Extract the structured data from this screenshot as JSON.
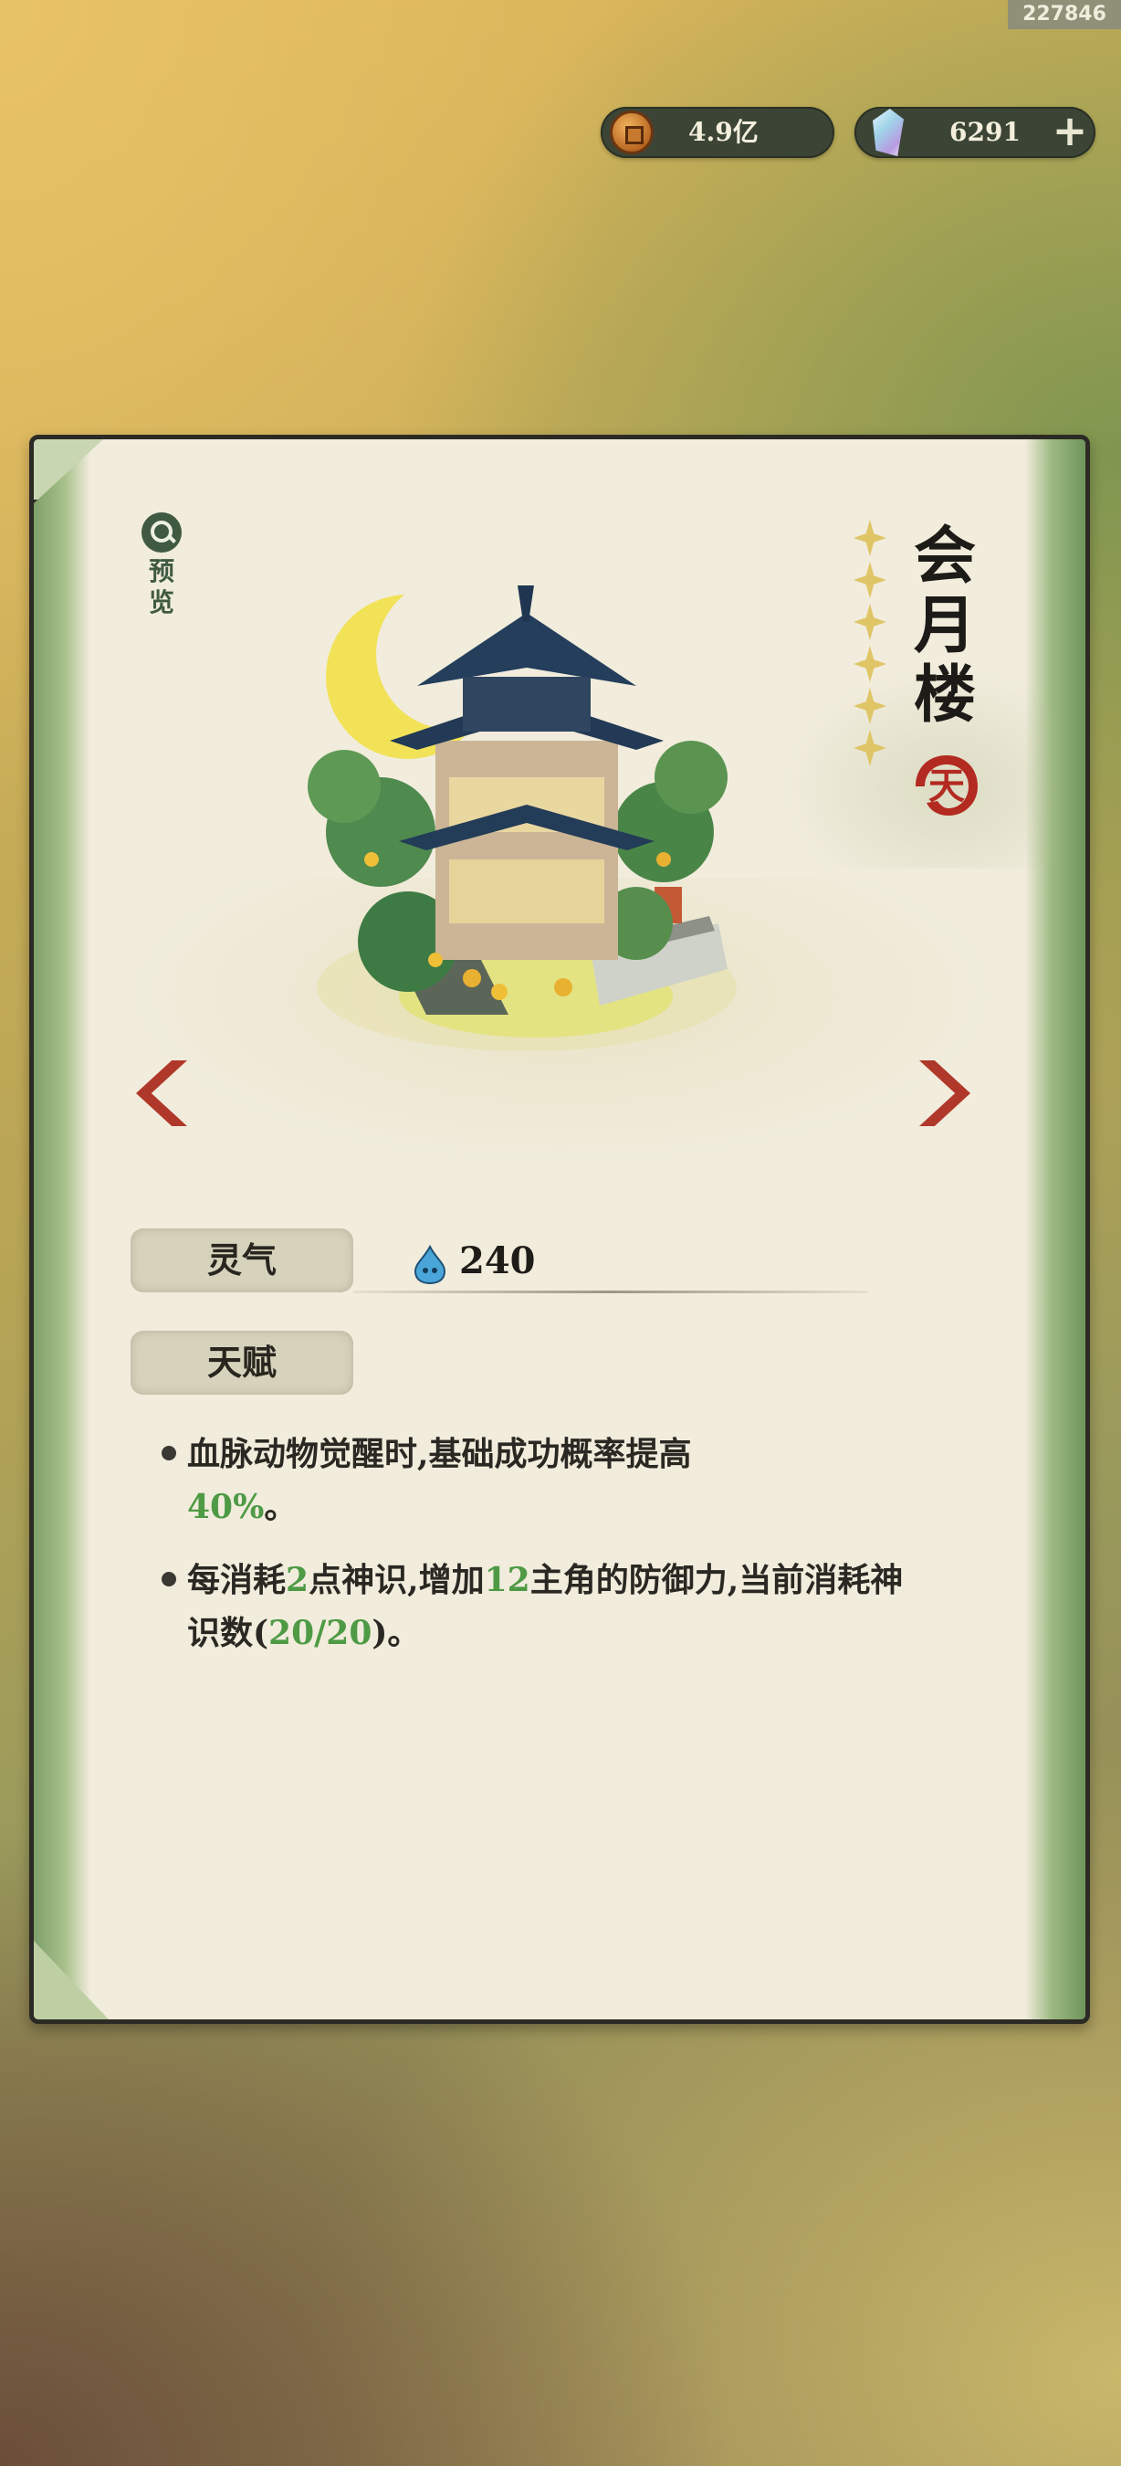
{
  "corner_id": "227846",
  "currency": {
    "coins": {
      "icon": "copper-coin-icon",
      "value": "4.9亿"
    },
    "gems": {
      "icon": "spirit-crystal-icon",
      "value": "6291",
      "add_icon": "plus-icon"
    }
  },
  "card": {
    "preview": {
      "icon": "magnifier-icon",
      "label": "预览"
    },
    "building_image": "moon-pavilion-illustration",
    "title": "会月楼",
    "grade_seal": "天",
    "stars": 6,
    "nav": {
      "prev_icon": "chevron-left-icon",
      "next_icon": "chevron-right-icon"
    },
    "lingqi": {
      "label": "灵气",
      "icon": "spirit-drop-icon",
      "value": "240"
    },
    "talent": {
      "label": "天赋",
      "items": [
        {
          "text_before": "血脉动物觉醒时,基础成功概率提高",
          "highlight": "40%",
          "text_after": "。"
        },
        {
          "text_before": "每消耗",
          "h1": "2",
          "text_mid1": "点神识,增加",
          "h2": "12",
          "text_mid2": "主角的防御力,当前消耗神识数(",
          "h3": "20/20",
          "text_after": ")。"
        }
      ]
    }
  },
  "colors": {
    "highlight_green": "#4e9a45",
    "arrow_red": "#b0382a",
    "seal_red": "#b32a21",
    "star_gold": "#e0c567"
  }
}
